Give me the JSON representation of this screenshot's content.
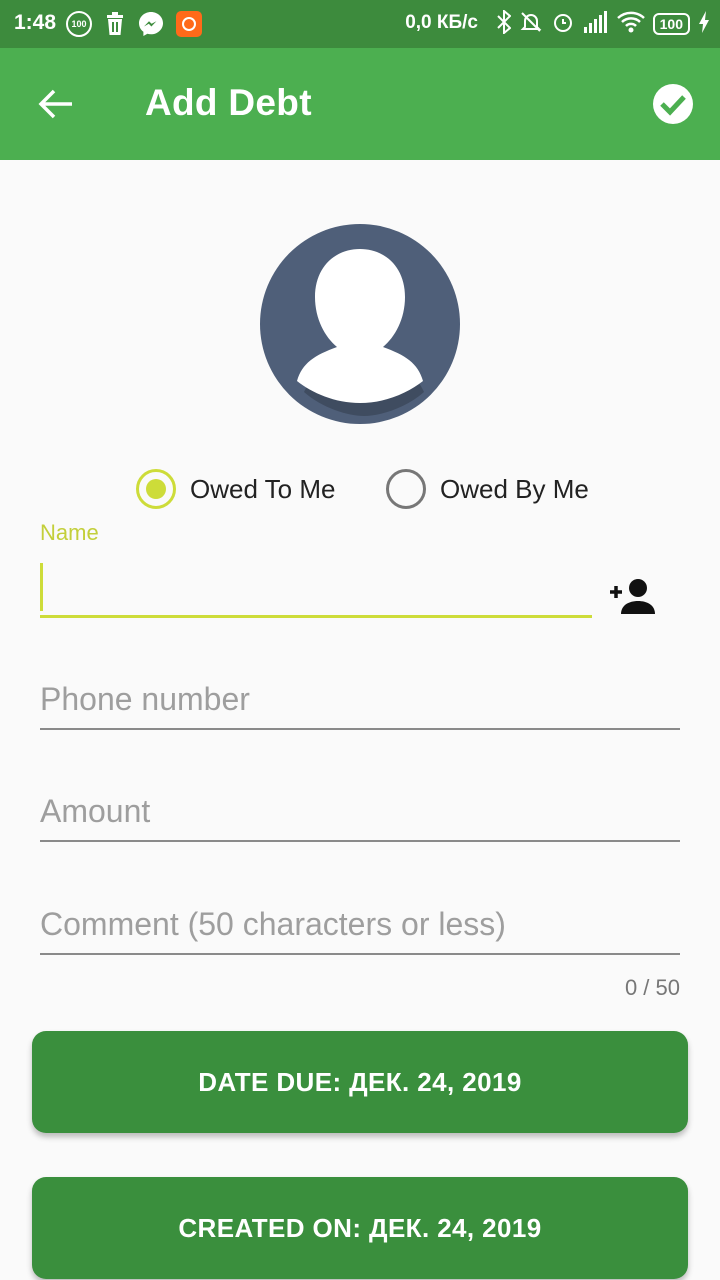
{
  "status_bar": {
    "time": "1:48",
    "badge_100": "100",
    "net_speed": "0,0 КБ/с",
    "battery": "100"
  },
  "toolbar": {
    "title": "Add Debt"
  },
  "radios": {
    "owed_to_me": "Owed To Me",
    "owed_by_me": "Owed By Me",
    "selected": "owed_to_me"
  },
  "form": {
    "name_label": "Name",
    "name_value": "",
    "phone_placeholder": "Phone number",
    "amount_placeholder": "Amount",
    "comment_placeholder": "Comment (50 characters or less)",
    "comment_counter": "0 / 50"
  },
  "buttons": {
    "date_due": "DATE DUE: ДЕК. 24, 2019",
    "created_on": "CREATED ON: ДЕК. 24, 2019"
  },
  "colors": {
    "status_bar": "#3d8b3d",
    "toolbar": "#4caf50",
    "accent": "#cddc39",
    "button": "#3a8f3d",
    "avatar_bg": "#4f5f79"
  }
}
